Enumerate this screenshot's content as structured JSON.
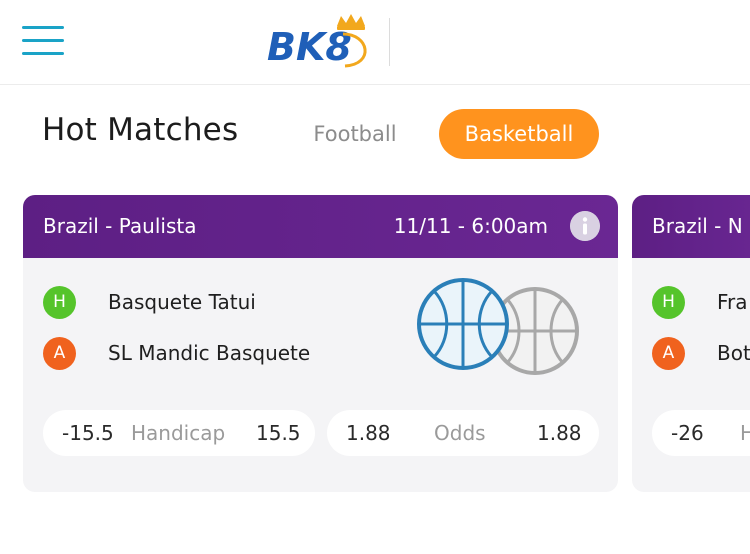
{
  "header": {
    "logo_text": "BK8",
    "icons": {
      "menu": "hamburger-menu-icon",
      "logo": "bk8-crown-logo"
    }
  },
  "section": {
    "title": "Hot Matches",
    "tabs": [
      {
        "label": "Football",
        "active": false
      },
      {
        "label": "Basketball",
        "active": true
      }
    ]
  },
  "matches": [
    {
      "league": "Brazil - Paulista",
      "time": "11/11 - 6:00am",
      "home": {
        "badge": "H",
        "name": "Basquete Tatui"
      },
      "away": {
        "badge": "A",
        "name": "SL Mandic Basquete"
      },
      "handicap": {
        "home": "-15.5",
        "label": "Handicap",
        "away": "15.5"
      },
      "odds": {
        "home": "1.88",
        "label": "Odds",
        "away": "1.88"
      }
    },
    {
      "league": "Brazil - N",
      "home": {
        "badge": "H",
        "name": "Fra"
      },
      "away": {
        "badge": "A",
        "name": "Bot"
      },
      "handicap": {
        "home": "-26",
        "label": "H"
      }
    }
  ],
  "colors": {
    "accent_orange": "#ff931e",
    "card_header_purple": "#5d1f84",
    "home_badge": "#55c42b",
    "away_badge": "#f0621e",
    "menu_teal": "#1aa3c7",
    "logo_blue": "#1f5fb8",
    "logo_gold": "#f2a81d"
  }
}
